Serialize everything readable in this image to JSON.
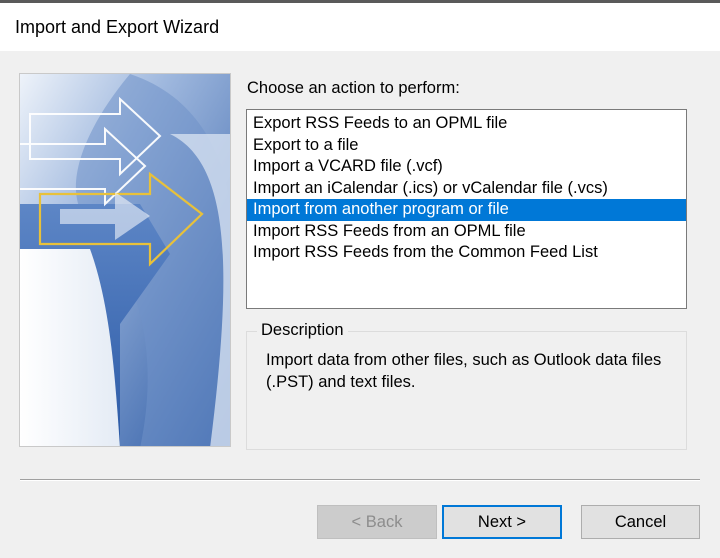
{
  "window": {
    "title": "Import and Export Wizard"
  },
  "main": {
    "prompt": "Choose an action to perform:",
    "actions": [
      "Export RSS Feeds to an OPML file",
      "Export to a file",
      "Import a VCARD file (.vcf)",
      "Import an iCalendar (.ics) or vCalendar file (.vcs)",
      "Import from another program or file",
      "Import RSS Feeds from an OPML file",
      "Import RSS Feeds from the Common Feed List"
    ],
    "selected_action": "Import from another program or file",
    "description": {
      "legend": "Description",
      "text": "Import data from other files, such as Outlook data files (.PST) and text files."
    }
  },
  "buttons": {
    "back": "< Back",
    "next": "Next >",
    "cancel": "Cancel"
  },
  "colors": {
    "selection": "#0078d7",
    "dialog_bg": "#f0f0f0",
    "banner_blue": "#2f5fa8"
  }
}
